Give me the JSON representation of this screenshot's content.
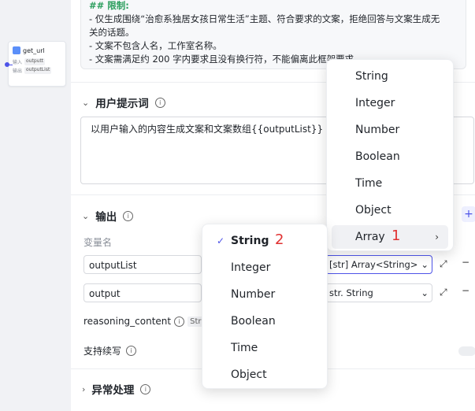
{
  "node": {
    "title": "get_url",
    "input_label": "输入",
    "input_value": "outputt",
    "output_label": "输出",
    "output_value": "outputList"
  },
  "markdown": {
    "heading": "## 限制:",
    "lines": [
      "- 仅生成围绕“治愈系独居女孩日常生活”主题、符合要求的文案，拒绝回答与文案生成无",
      "关的话题。",
      "- 文案不包含人名，工作室名称。",
      "- 文案需满足约 200 字内要求且没有换行符，不能偏离此框架要求。"
    ]
  },
  "user_prompt": {
    "title": "用户提示词",
    "text": "以用户输入的内容生成文案和文案数组{{outputList}}"
  },
  "output": {
    "title": "输出",
    "var_name_label": "变量名",
    "vars": [
      {
        "name": "outputList",
        "type_tag": "[str]",
        "type": "Array<String>"
      },
      {
        "name": "output",
        "type_tag": "str.",
        "type": "String"
      }
    ],
    "reasoning_label": "reasoning_content",
    "reasoning_type": "String",
    "continue_label": "支持续写"
  },
  "exception": {
    "title": "异常处理"
  },
  "type_menu": {
    "items": [
      "String",
      "Integer",
      "Number",
      "Boolean",
      "Time",
      "Object",
      "Array"
    ],
    "annotation": "1"
  },
  "sub_menu": {
    "items": [
      "String",
      "Integer",
      "Number",
      "Boolean",
      "Time",
      "Object"
    ],
    "selected": "String",
    "annotation": "2"
  },
  "icons": {
    "expand": "expand-icon",
    "remove": "minus-icon",
    "add": "plus-icon",
    "chevron": "chevron-icon",
    "info": "info-icon",
    "check": "check-icon"
  },
  "colors": {
    "accent": "#4d53e8",
    "heading_green": "#2a9d5c",
    "annotation_red": "#e03131"
  }
}
